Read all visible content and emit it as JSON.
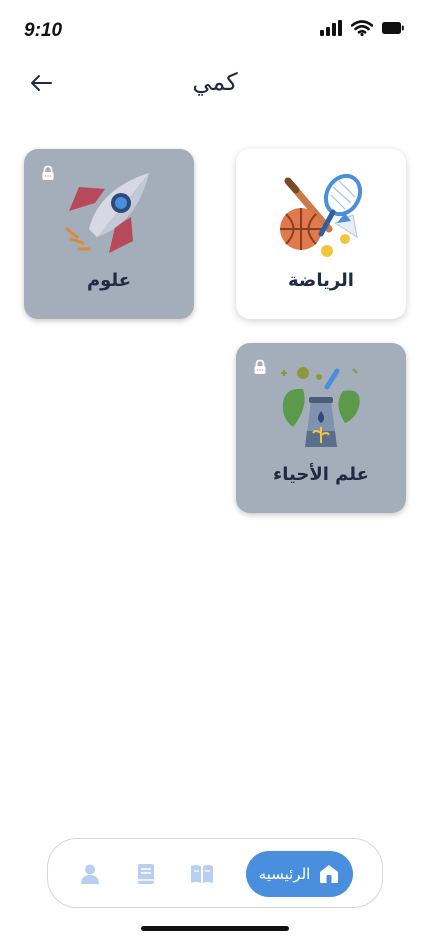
{
  "status_bar": {
    "time": "9:10"
  },
  "header": {
    "title": "كمي"
  },
  "cards": [
    {
      "label": "الرياضة",
      "locked": false,
      "icon": "sports-icon"
    },
    {
      "label": "علوم",
      "locked": true,
      "icon": "rocket-icon"
    },
    {
      "label": "علم الأحياء",
      "locked": true,
      "icon": "biology-icon"
    }
  ],
  "bottom_nav": {
    "home_label": "الرئيسيه",
    "items": [
      "profile-icon",
      "book-icon",
      "reader-icon",
      "home-icon"
    ]
  },
  "colors": {
    "accent": "#4a8ede",
    "locked_card": "#a4adba",
    "title": "#1f2a44"
  }
}
